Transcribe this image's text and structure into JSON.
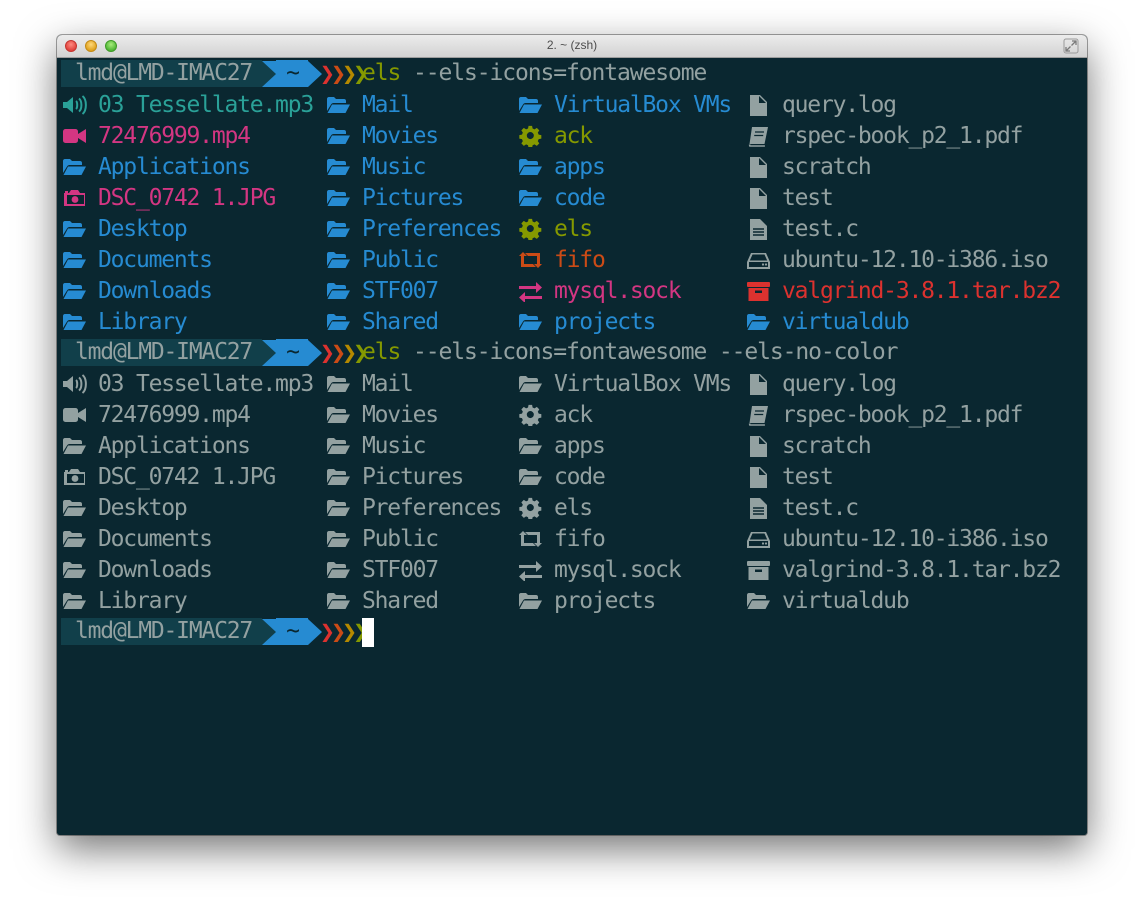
{
  "window": {
    "title": "2. ~ (zsh)"
  },
  "prompt": {
    "user_host": "lmd@LMD-IMAC27",
    "dir": "~",
    "colors": {
      "host_bg": "#113f4a",
      "dir_bg": "#268bd2",
      "chevrons": [
        "#dc322f",
        "#cb4b16",
        "#b58900",
        "#859900"
      ]
    }
  },
  "commands": [
    {
      "cmd": "els",
      "args": "--els-icons=fontawesome"
    },
    {
      "cmd": "els",
      "args": "--els-icons=fontawesome --els-no-color"
    }
  ],
  "listing": {
    "columns": [
      [
        {
          "name": "03 Tessellate.mp3",
          "icon": "volume-up-icon",
          "color": "cyan"
        },
        {
          "name": "72476999.mp4",
          "icon": "video-camera-icon",
          "color": "magenta"
        },
        {
          "name": "Applications",
          "icon": "folder-open-icon",
          "color": "blue"
        },
        {
          "name": "DSC_0742 1.JPG",
          "icon": "camera-icon",
          "color": "magenta"
        },
        {
          "name": "Desktop",
          "icon": "folder-open-icon",
          "color": "blue"
        },
        {
          "name": "Documents",
          "icon": "folder-open-icon",
          "color": "blue"
        },
        {
          "name": "Downloads",
          "icon": "folder-open-icon",
          "color": "blue"
        },
        {
          "name": "Library",
          "icon": "folder-open-icon",
          "color": "blue"
        }
      ],
      [
        {
          "name": "Mail",
          "icon": "folder-open-icon",
          "color": "blue"
        },
        {
          "name": "Movies",
          "icon": "folder-open-icon",
          "color": "blue"
        },
        {
          "name": "Music",
          "icon": "folder-open-icon",
          "color": "blue"
        },
        {
          "name": "Pictures",
          "icon": "folder-open-icon",
          "color": "blue"
        },
        {
          "name": "Preferences",
          "icon": "folder-open-icon",
          "color": "blue"
        },
        {
          "name": "Public",
          "icon": "folder-open-icon",
          "color": "blue"
        },
        {
          "name": "STF007",
          "icon": "folder-open-icon",
          "color": "blue"
        },
        {
          "name": "Shared",
          "icon": "folder-open-icon",
          "color": "blue"
        }
      ],
      [
        {
          "name": "VirtualBox VMs",
          "icon": "folder-open-icon",
          "color": "blue"
        },
        {
          "name": "ack",
          "icon": "gear-icon",
          "color": "green"
        },
        {
          "name": "apps",
          "icon": "folder-open-icon",
          "color": "blue"
        },
        {
          "name": "code",
          "icon": "folder-open-icon",
          "color": "blue"
        },
        {
          "name": "els",
          "icon": "gear-icon",
          "color": "green"
        },
        {
          "name": "fifo",
          "icon": "retweet-icon",
          "color": "orange"
        },
        {
          "name": "mysql.sock",
          "icon": "exchange-icon",
          "color": "magenta"
        },
        {
          "name": "projects",
          "icon": "folder-open-icon",
          "color": "blue"
        }
      ],
      [
        {
          "name": "query.log",
          "icon": "file-icon",
          "color": "plain"
        },
        {
          "name": "rspec-book_p2_1.pdf",
          "icon": "book-icon",
          "color": "plain"
        },
        {
          "name": "scratch",
          "icon": "file-icon",
          "color": "plain"
        },
        {
          "name": "test",
          "icon": "file-icon",
          "color": "plain"
        },
        {
          "name": "test.c",
          "icon": "file-text-icon",
          "color": "plain"
        },
        {
          "name": "ubuntu-12.10-i386.iso",
          "icon": "hdd-icon",
          "color": "plain"
        },
        {
          "name": "valgrind-3.8.1.tar.bz2",
          "icon": "archive-icon",
          "color": "red"
        },
        {
          "name": "virtualdub",
          "icon": "folder-open-icon",
          "color": "blue"
        }
      ]
    ]
  }
}
